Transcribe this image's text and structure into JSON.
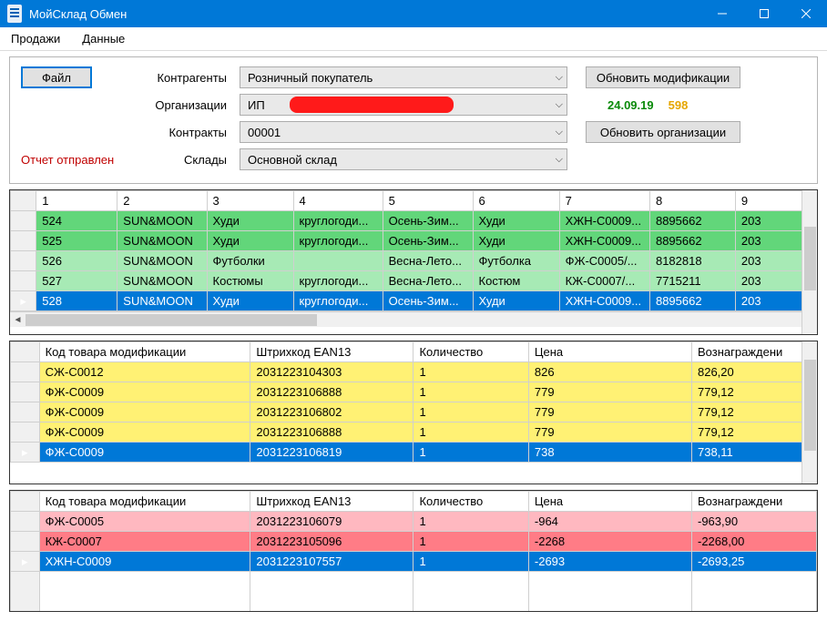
{
  "window": {
    "title": "МойСклад Обмен"
  },
  "menu": {
    "sales": "Продажи",
    "data": "Данные"
  },
  "top": {
    "file_btn": "Файл",
    "labels": {
      "counterparties": "Контрагенты",
      "organizations": "Организации",
      "contracts": "Контракты",
      "warehouses": "Склады"
    },
    "combos": {
      "counterparty": "Розничный покупатель",
      "organization_prefix": "ИП",
      "contract": "00001",
      "warehouse": "Основной склад"
    },
    "buttons": {
      "update_mods": "Обновить модификации",
      "update_orgs": "Обновить организации"
    },
    "date": "24.09.19",
    "count": "598",
    "status": "Отчет отправлен"
  },
  "grid1": {
    "headers": [
      "1",
      "2",
      "3",
      "4",
      "5",
      "6",
      "7",
      "8",
      "9"
    ],
    "rows": [
      {
        "style": "dark",
        "cells": [
          "524",
          "SUN&MOON",
          "Худи",
          "круглогоди...",
          "Осень-Зим...",
          "Худи",
          "ХЖН-С0009...",
          "8895662",
          "203"
        ]
      },
      {
        "style": "dark",
        "cells": [
          "525",
          "SUN&MOON",
          "Худи",
          "круглогоди...",
          "Осень-Зим...",
          "Худи",
          "ХЖН-С0009...",
          "8895662",
          "203"
        ]
      },
      {
        "style": "light",
        "cells": [
          "526",
          "SUN&MOON",
          "Футболки",
          "",
          "Весна-Лето...",
          "Футболка",
          "ФЖ-С0005/...",
          "8182818",
          "203"
        ]
      },
      {
        "style": "light",
        "cells": [
          "527",
          "SUN&MOON",
          "Костюмы",
          "круглогоди...",
          "Весна-Лето...",
          "Костюм",
          "КЖ-С0007/...",
          "7715211",
          "203"
        ]
      },
      {
        "style": "sel",
        "cells": [
          "528",
          "SUN&MOON",
          "Худи",
          "круглогоди...",
          "Осень-Зим...",
          "Худи",
          "ХЖН-С0009...",
          "8895662",
          "203"
        ]
      }
    ]
  },
  "grid2": {
    "headers": [
      "Код товара модификации",
      "Штрихкод EAN13",
      "Количество",
      "Цена",
      "Вознаграждени"
    ],
    "rows": [
      {
        "cells": [
          "СЖ-С0012",
          "2031223104303",
          "1",
          "826",
          "826,20"
        ]
      },
      {
        "cells": [
          "ФЖ-С0009",
          "2031223106888",
          "1",
          "779",
          "779,12"
        ]
      },
      {
        "cells": [
          "ФЖ-С0009",
          "2031223106802",
          "1",
          "779",
          "779,12"
        ]
      },
      {
        "cells": [
          "ФЖ-С0009",
          "2031223106888",
          "1",
          "779",
          "779,12"
        ]
      },
      {
        "style": "sel",
        "cells": [
          "ФЖ-С0009",
          "2031223106819",
          "1",
          "738",
          "738,11"
        ]
      }
    ]
  },
  "grid3": {
    "headers": [
      "Код товара модификации",
      "Штрихкод EAN13",
      "Количество",
      "Цена",
      "Вознаграждени"
    ],
    "rows": [
      {
        "style": "r1",
        "cells": [
          "ФЖ-С0005",
          "2031223106079",
          "1",
          "-964",
          "-963,90"
        ]
      },
      {
        "style": "r2",
        "cells": [
          "КЖ-С0007",
          "2031223105096",
          "1",
          "-2268",
          "-2268,00"
        ]
      },
      {
        "style": "sel",
        "cells": [
          "ХЖН-С0009",
          "2031223107557",
          "1",
          "-2693",
          "-2693,25"
        ]
      }
    ]
  }
}
